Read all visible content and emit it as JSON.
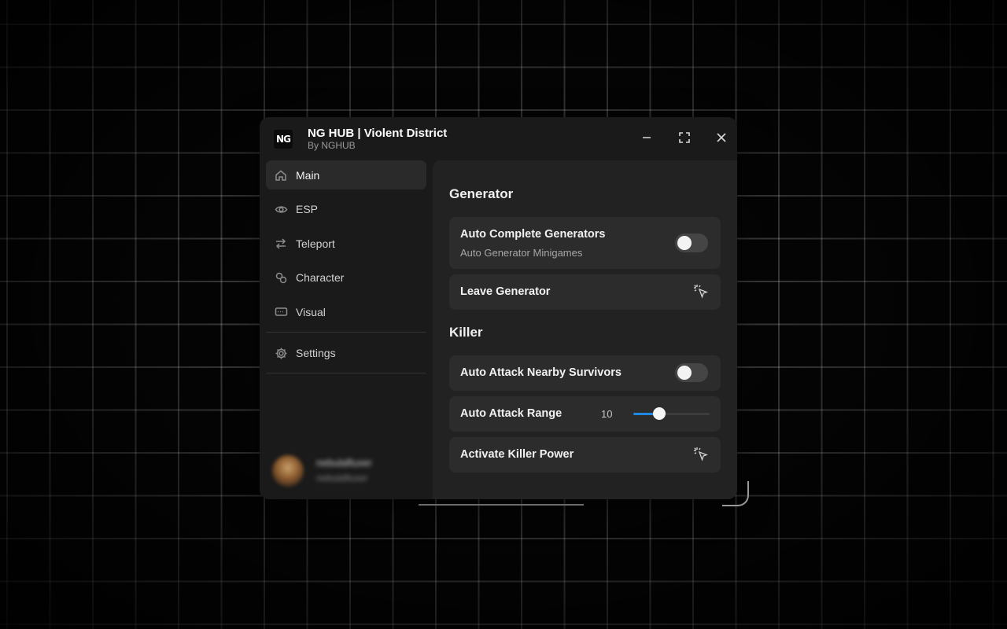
{
  "window": {
    "logo_text": "NG",
    "title": "NG HUB | Violent District",
    "subtitle": "By NGHUB"
  },
  "sidebar": {
    "items": [
      {
        "label": "Main",
        "icon": "home-icon",
        "active": true
      },
      {
        "label": "ESP",
        "icon": "eye-icon",
        "active": false
      },
      {
        "label": "Teleport",
        "icon": "swap-arrows-icon",
        "active": false
      },
      {
        "label": "Character",
        "icon": "character-icon",
        "active": false
      },
      {
        "label": "Visual",
        "icon": "display-icon",
        "active": false
      }
    ],
    "settings": {
      "label": "Settings",
      "icon": "gear-icon"
    }
  },
  "profile": {
    "display_name": "nebulafluxer",
    "username": "nebulafluxer"
  },
  "main": {
    "sections": {
      "generator": {
        "title": "Generator",
        "auto_complete": {
          "label": "Auto Complete Generators",
          "description": "Auto Generator Minigames",
          "enabled": false
        },
        "leave": {
          "label": "Leave Generator"
        }
      },
      "killer": {
        "title": "Killer",
        "auto_attack": {
          "label": "Auto Attack Nearby Survivors",
          "enabled": false
        },
        "range": {
          "label": "Auto Attack Range",
          "value": "10",
          "fill_fraction": 0.34
        },
        "power": {
          "label": "Activate Killer Power"
        }
      }
    }
  },
  "colors": {
    "accent": "#1e88e5",
    "window_bg": "#1a1a1a",
    "panel_bg": "#222222",
    "row_bg": "#2c2c2c"
  }
}
